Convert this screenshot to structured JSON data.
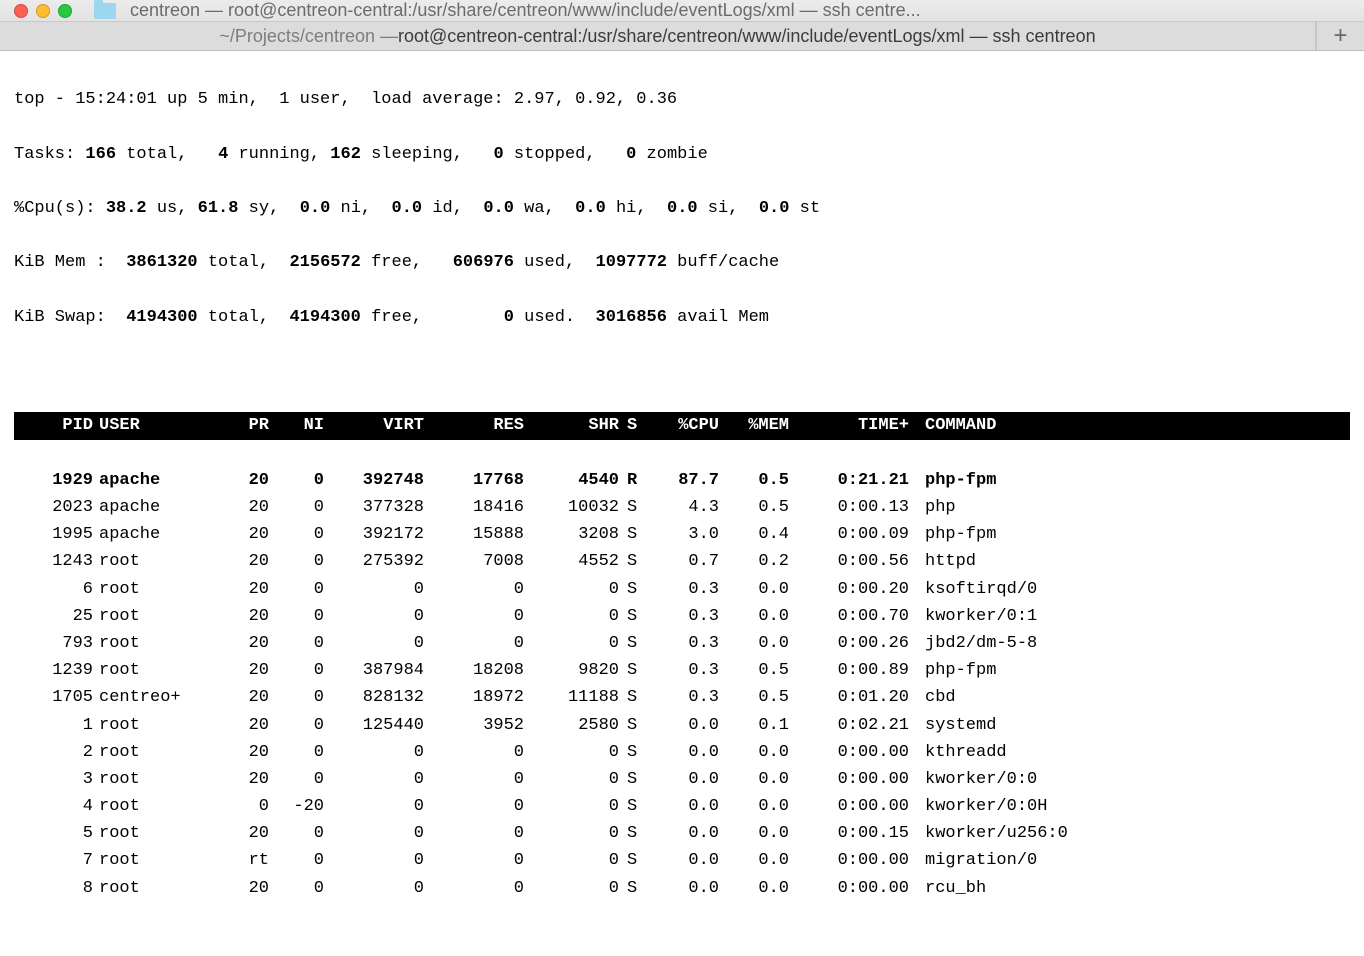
{
  "window": {
    "title": "centreon — root@centreon-central:/usr/share/centreon/www/include/eventLogs/xml — ssh centre..."
  },
  "tab": {
    "path_prefix": "~/Projects/centreon — ",
    "label": "root@centreon-central:/usr/share/centreon/www/include/eventLogs/xml — ssh centreon",
    "new_tab_glyph": "+"
  },
  "top": {
    "line1_pre": "top - ",
    "line1_rest": "15:24:01 up 5 min,  1 user,  load average: 2.97, 0.92, 0.36",
    "tasks_label": "Tasks: ",
    "tasks_total": "166",
    "tasks_total_l": " total,   ",
    "tasks_run": "4",
    "tasks_run_l": " running, ",
    "tasks_sleep": "162",
    "tasks_sleep_l": " sleeping,   ",
    "tasks_stop": "0",
    "tasks_stop_l": " stopped,   ",
    "tasks_zomb": "0",
    "tasks_zomb_l": " zombie",
    "cpu_label": "%Cpu(s): ",
    "cpu_us": "38.2",
    "cpu_us_l": " us, ",
    "cpu_sy": "61.8",
    "cpu_sy_l": " sy,  ",
    "cpu_ni": "0.0",
    "cpu_ni_l": " ni,  ",
    "cpu_id": "0.0",
    "cpu_id_l": " id,  ",
    "cpu_wa": "0.0",
    "cpu_wa_l": " wa,  ",
    "cpu_hi": "0.0",
    "cpu_hi_l": " hi,  ",
    "cpu_si": "0.0",
    "cpu_si_l": " si,  ",
    "cpu_st": "0.0",
    "cpu_st_l": " st",
    "mem_label": "KiB Mem :  ",
    "mem_total": "3861320",
    "mem_total_l": " total,  ",
    "mem_free": "2156572",
    "mem_free_l": " free,   ",
    "mem_used": "606976",
    "mem_used_l": " used,  ",
    "mem_buff": "1097772",
    "mem_buff_l": " buff/cache",
    "swap_label": "KiB Swap:  ",
    "swap_total": "4194300",
    "swap_total_l": " total,  ",
    "swap_free": "4194300",
    "swap_free_l": " free,        ",
    "swap_used": "0",
    "swap_used_l": " used.  ",
    "swap_avail": "3016856",
    "swap_avail_l": " avail Mem"
  },
  "columns": {
    "pid": "PID",
    "user": "USER",
    "pr": "PR",
    "ni": "NI",
    "virt": "VIRT",
    "res": "RES",
    "shr": "SHR",
    "s": "S",
    "cpu": "%CPU",
    "mem": "%MEM",
    "time": "TIME+",
    "cmd": "COMMAND"
  },
  "processes": [
    {
      "pid": "1929",
      "user": "apache",
      "pr": "20",
      "ni": "0",
      "virt": "392748",
      "res": "17768",
      "shr": "4540",
      "s": "R",
      "cpu": "87.7",
      "mem": "0.5",
      "time": "0:21.21",
      "cmd": "php-fpm",
      "sel": true
    },
    {
      "pid": "2023",
      "user": "apache",
      "pr": "20",
      "ni": "0",
      "virt": "377328",
      "res": "18416",
      "shr": "10032",
      "s": "S",
      "cpu": "4.3",
      "mem": "0.5",
      "time": "0:00.13",
      "cmd": "php"
    },
    {
      "pid": "1995",
      "user": "apache",
      "pr": "20",
      "ni": "0",
      "virt": "392172",
      "res": "15888",
      "shr": "3208",
      "s": "S",
      "cpu": "3.0",
      "mem": "0.4",
      "time": "0:00.09",
      "cmd": "php-fpm"
    },
    {
      "pid": "1243",
      "user": "root",
      "pr": "20",
      "ni": "0",
      "virt": "275392",
      "res": "7008",
      "shr": "4552",
      "s": "S",
      "cpu": "0.7",
      "mem": "0.2",
      "time": "0:00.56",
      "cmd": "httpd"
    },
    {
      "pid": "6",
      "user": "root",
      "pr": "20",
      "ni": "0",
      "virt": "0",
      "res": "0",
      "shr": "0",
      "s": "S",
      "cpu": "0.3",
      "mem": "0.0",
      "time": "0:00.20",
      "cmd": "ksoftirqd/0"
    },
    {
      "pid": "25",
      "user": "root",
      "pr": "20",
      "ni": "0",
      "virt": "0",
      "res": "0",
      "shr": "0",
      "s": "S",
      "cpu": "0.3",
      "mem": "0.0",
      "time": "0:00.70",
      "cmd": "kworker/0:1"
    },
    {
      "pid": "793",
      "user": "root",
      "pr": "20",
      "ni": "0",
      "virt": "0",
      "res": "0",
      "shr": "0",
      "s": "S",
      "cpu": "0.3",
      "mem": "0.0",
      "time": "0:00.26",
      "cmd": "jbd2/dm-5-8"
    },
    {
      "pid": "1239",
      "user": "root",
      "pr": "20",
      "ni": "0",
      "virt": "387984",
      "res": "18208",
      "shr": "9820",
      "s": "S",
      "cpu": "0.3",
      "mem": "0.5",
      "time": "0:00.89",
      "cmd": "php-fpm"
    },
    {
      "pid": "1705",
      "user": "centreo+",
      "pr": "20",
      "ni": "0",
      "virt": "828132",
      "res": "18972",
      "shr": "11188",
      "s": "S",
      "cpu": "0.3",
      "mem": "0.5",
      "time": "0:01.20",
      "cmd": "cbd"
    },
    {
      "pid": "1",
      "user": "root",
      "pr": "20",
      "ni": "0",
      "virt": "125440",
      "res": "3952",
      "shr": "2580",
      "s": "S",
      "cpu": "0.0",
      "mem": "0.1",
      "time": "0:02.21",
      "cmd": "systemd"
    },
    {
      "pid": "2",
      "user": "root",
      "pr": "20",
      "ni": "0",
      "virt": "0",
      "res": "0",
      "shr": "0",
      "s": "S",
      "cpu": "0.0",
      "mem": "0.0",
      "time": "0:00.00",
      "cmd": "kthreadd"
    },
    {
      "pid": "3",
      "user": "root",
      "pr": "20",
      "ni": "0",
      "virt": "0",
      "res": "0",
      "shr": "0",
      "s": "S",
      "cpu": "0.0",
      "mem": "0.0",
      "time": "0:00.00",
      "cmd": "kworker/0:0"
    },
    {
      "pid": "4",
      "user": "root",
      "pr": "0",
      "ni": "-20",
      "virt": "0",
      "res": "0",
      "shr": "0",
      "s": "S",
      "cpu": "0.0",
      "mem": "0.0",
      "time": "0:00.00",
      "cmd": "kworker/0:0H"
    },
    {
      "pid": "5",
      "user": "root",
      "pr": "20",
      "ni": "0",
      "virt": "0",
      "res": "0",
      "shr": "0",
      "s": "S",
      "cpu": "0.0",
      "mem": "0.0",
      "time": "0:00.15",
      "cmd": "kworker/u256:0"
    },
    {
      "pid": "7",
      "user": "root",
      "pr": "rt",
      "ni": "0",
      "virt": "0",
      "res": "0",
      "shr": "0",
      "s": "S",
      "cpu": "0.0",
      "mem": "0.0",
      "time": "0:00.00",
      "cmd": "migration/0"
    },
    {
      "pid": "8",
      "user": "root",
      "pr": "20",
      "ni": "0",
      "virt": "0",
      "res": "0",
      "shr": "0",
      "s": "S",
      "cpu": "0.0",
      "mem": "0.0",
      "time": "0:00.00",
      "cmd": "rcu_bh"
    }
  ]
}
